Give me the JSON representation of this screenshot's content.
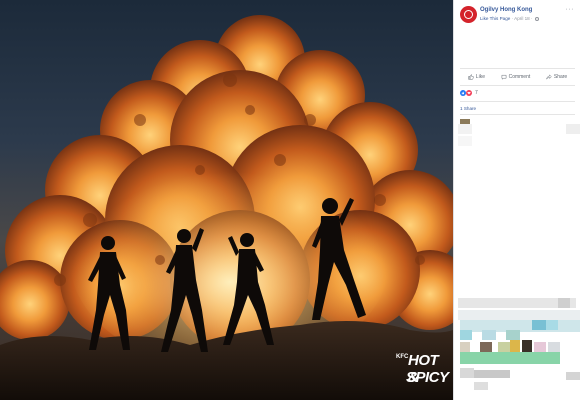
{
  "photo": {
    "logo": {
      "brand": "KFC",
      "line1": "HOT &",
      "line2": "SPICY"
    }
  },
  "post": {
    "page_name": "Ogilvy Hong Kong",
    "like_page": "Like This Page",
    "date": "April 18",
    "more": "···",
    "actions": [
      {
        "label": "Like",
        "icon": "thumbs-up-icon"
      },
      {
        "label": "Comment",
        "icon": "comment-icon"
      },
      {
        "label": "Share",
        "icon": "share-icon"
      }
    ],
    "reaction_count": "7",
    "shares": "1 Share"
  },
  "colors": {
    "link": "#365899",
    "brand": "#d4232b",
    "like_blue": "#2078f4",
    "love_red": "#f33e58"
  }
}
